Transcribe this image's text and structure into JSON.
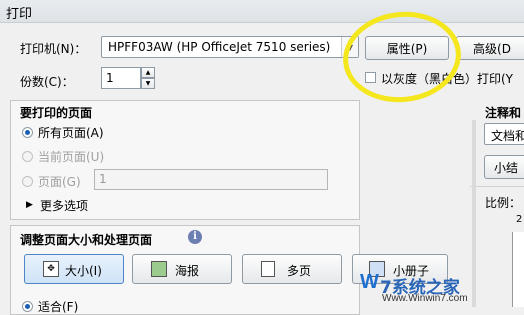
{
  "window": {
    "title": "打印"
  },
  "printer": {
    "label": "打印机(N)：",
    "selected": "HPFF03AW (HP OfficeJet 7510 series)",
    "properties_button": "属性(P)",
    "advanced_button": "高级(D"
  },
  "copies": {
    "label": "份数(C)：",
    "value": "1"
  },
  "grayscale": {
    "label": "以灰度（黑白色）打印(Y",
    "checked": false
  },
  "pages_to_print": {
    "heading": "要打印的页面",
    "all_pages": "所有页面(A)",
    "current_page": "当前页面(U)",
    "pages": "页面(G)",
    "pages_value": "1",
    "more_options": "更多选项"
  },
  "page_sizing": {
    "heading": "调整页面大小和处理页面",
    "size_button": "大小(I)",
    "poster_button": "海报",
    "multiple_button": "多页",
    "booklet_button": "小册子",
    "fit_option": "适合(F)"
  },
  "comments_forms": {
    "heading": "注释和",
    "combo_value": "文档和",
    "summary_button": "小结"
  },
  "preview": {
    "scale_label": "比例：",
    "ruler_value": "2"
  },
  "watermark": {
    "brand_w": "W",
    "brand_rest": "7系统之家",
    "url": "Www.Winwin7.com"
  },
  "colors": {
    "highlight_ring": "#f5e71d",
    "selected_radio": "#1b5fb4"
  }
}
